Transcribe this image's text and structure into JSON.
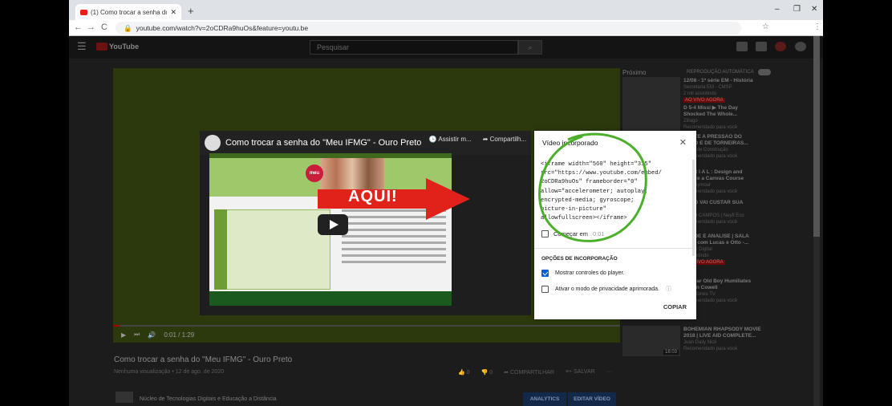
{
  "browser": {
    "tab_title": "(1) Como trocar a senha do \"Me…",
    "tab_close": "✕",
    "new_tab": "+",
    "url": "youtube.com/watch?v=2oCDRa9huOs&feature=youtu.be",
    "minimize": "–",
    "maximize": "❐",
    "close": "✕",
    "back": "←",
    "forward": "→",
    "reload": "C",
    "star": "☆",
    "menu": "⋮"
  },
  "youtube": {
    "logo_text": "YouTube",
    "search_placeholder": "Pesquisar",
    "menu": "☰",
    "search_icon": "🔍"
  },
  "player": {
    "overlay_title": "Como trocar a senha do \"Meu IFMG\" - Ouro Preto",
    "assistir": "Assistir m...",
    "compartilhar": "Compartilh...",
    "time": "0:01 / 1:29",
    "meu": "meu",
    "progress_fraction": 0.013
  },
  "annotation": {
    "label": "AQUI!",
    "arrow_color": "#e0221b",
    "circle_color": "#4caf2a"
  },
  "dialog": {
    "title": "Vídeo incorporado",
    "close": "✕",
    "code": "<iframe width=\"560\" height=\"315\"\nsrc=\"https://www.youtube.com/embed/\n2oCDRa9huOs\" frameborder=\"0\"\nallow=\"accelerometer; autoplay;\nencrypted-media; gyroscope;\npicture-in-picture\"\nallowfullscreen></iframe>",
    "start_label": "Começar em",
    "start_time": "0:01",
    "options_title": "OPÇÕES DE INCORPORAÇÃO",
    "option1": "Mostrar controles do player.",
    "option2": "Ativar o modo de privacidade aprimorada.",
    "info": "ⓘ",
    "copy": "COPIAR"
  },
  "video": {
    "title": "Como trocar a senha do \"Meu IFMG\" - Ouro Preto",
    "meta": "Nenhuma visualização • 12 de ago. de 2020",
    "likes": "0",
    "dislikes": "0",
    "share": "COMPARTILHAR",
    "save": "SALVAR",
    "more": "···",
    "channel": "Núcleo de Tecnologias Digitais e Educação a Distância",
    "analytics": "ANALYTICS",
    "edit": "EDITAR VÍDEO"
  },
  "sidebar": {
    "proximo": "Próximo",
    "autoplay": "REPRODUÇÃO AUTOMÁTICA",
    "items": [
      {
        "title": "12/08 - 1ª série EM - História",
        "channel": "Secretaria EM - CMSP",
        "views": "2 mil assistindo",
        "badge": "AO VIVO AGORA",
        "dur": ""
      },
      {
        "title": "D 5-4 Missi ▶ The Day",
        "title2": "Shocked The Whole...",
        "channel": "Zillago",
        "views": "Recomendado para você",
        "badge": "",
        "dur": ""
      },
      {
        "title": "VENTE A PRESSÃO DO",
        "title2": "VARO E DE TORNEIRAS...",
        "channel": "Dicas de Construção",
        "views": "Recomendado para você",
        "badge": "",
        "dur": ""
      },
      {
        "title": "T O R I A L : Design and",
        "title2": "tomize a Canvas Course",
        "channel": "Ian Seymour",
        "views": "Recomendado para você",
        "badge": "",
        "dur": ""
      },
      {
        "title": "ANTO VAI CUSTAR SUA",
        "title2": "A ?!",
        "channel": "ADRO CAMPOS | Neyfi Eco",
        "views": "Recomendado para você",
        "badge": "",
        "dur": ""
      },
      {
        "title": "TRADE E ANALISE | SALA",
        "title2": "VIVO com Lucas e Otto -...",
        "channel": "Trader Digital",
        "views": "2 assistindo",
        "badge": "AO VIVO AGORA",
        "dur": ""
      },
      {
        "title": "12 Year Old Boy Humiliates",
        "title2": "Simon Cowell",
        "channel": "Gary Jones TV",
        "views": "Recomendado para você",
        "badge": "",
        "dur": "5:37"
      },
      {
        "title": "BOHEMIAN RHAPSODY MOVIE",
        "title2": "2018 | LIVE AID COMPLETE...",
        "channel": "Juan Daily Nick",
        "views": "Recomendado para você",
        "badge": "",
        "dur": "18:03"
      }
    ]
  }
}
